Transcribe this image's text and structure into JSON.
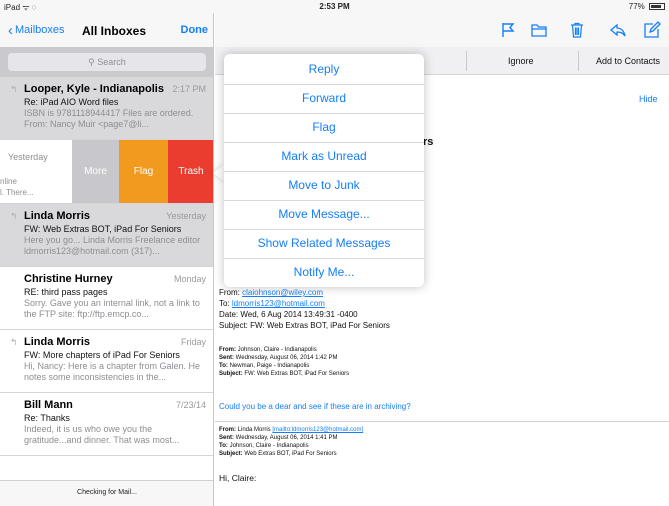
{
  "status_bar": {
    "left": "iPad ᯤ ◌",
    "time": "2:53 PM",
    "battery": "77%"
  },
  "mailbox": {
    "back_label": "Mailboxes",
    "title": "All Inboxes",
    "done_label": "Done",
    "search_placeholder": "Search",
    "messages": [
      {
        "sender": "Looper, Kyle - Indianapolis",
        "date": "2:17 PM",
        "subject": "Re: iPad AIO Word files",
        "preview": "ISBN is 9781118944417 Files are ordered. From: Nancy Muir <page7@li..."
      },
      {
        "sender": "Linda Morris",
        "date": "Yesterday",
        "subject": "FW: Web Extras BOT, iPad For Seniors",
        "preview": "Here you go... Linda Morris Freelance editor ldmorris123@hotmail.com (317)..."
      },
      {
        "sender": "Christine Hurney",
        "date": "Monday",
        "subject": "RE: third pass pages",
        "preview": "Sorry. Gave you an internal link, not a link to the FTP site: ftp://ftp.emcp.co..."
      },
      {
        "sender": "Linda Morris",
        "date": "Friday",
        "subject": "FW: More chapters of iPad For Seniors",
        "preview": "Hi, Nancy: Here is a chapter from Galen. He notes some inconsistencies in the..."
      },
      {
        "sender": "Bill Mann",
        "date": "7/23/14",
        "subject": "Re: Thanks",
        "preview": "Indeed, it is us who owe you the gratitude...and dinner. That was most..."
      }
    ],
    "swiped_row": {
      "date": "Yesterday",
      "line1": "nline",
      "line2": "l. There...",
      "more_label": "More",
      "flag_label": "Flag",
      "trash_label": "Trash"
    },
    "footer_status": "Checking for Mail..."
  },
  "toolbar": {
    "icons": [
      "flag-icon",
      "folder-icon",
      "trash-icon",
      "reply-icon",
      "compose-icon"
    ]
  },
  "contact_bar": {
    "ignore_label": "Ignore",
    "add_label": "Add to Contacts"
  },
  "message": {
    "hide_label": "Hide",
    "subject_fragment": "rs",
    "from_label": "From:",
    "from_value": "claiohnson@wiley.com",
    "to_label": "To:",
    "to_value": "ldmorris123@hotmail.com",
    "date_line": "Date: Wed, 6 Aug 2014 13:49:31 -0400",
    "subject_line": "Subject: FW: Web Extras BOT, iPad For Seniors",
    "block1": {
      "from_label": "From:",
      "from_value": "Johnson, Claire - Indianapolis",
      "sent_label": "Sent:",
      "sent_value": "Wednesday, August 06, 2014 1:42 PM",
      "to_label": "To:",
      "to_value": "Newman, Paige - Indianapolis",
      "subject_label": "Subject:",
      "subject_value": "FW: Web Extras BOT, iPad For Seniors"
    },
    "question": "Could you be a dear and see if these are in archiving?",
    "block2": {
      "from_label": "From:",
      "from_value": "Linda Morris",
      "from_link": "[mailto:ldmorris123@hotmail.com]",
      "sent_label": "Sent:",
      "sent_value": "Wednesday, August 06, 2014 1:41 PM",
      "to_label": "To:",
      "to_value": "Johnson, Claire - Indianapolis",
      "subject_label": "Subject:",
      "subject_value": "Web Extras BOT, iPad For Seniors"
    },
    "greeting": "Hi, Claire:"
  },
  "popover": {
    "items": [
      "Reply",
      "Forward",
      "Flag",
      "Mark as Unread",
      "Move to Junk",
      "Move Message...",
      "Show Related Messages",
      "Notify Me..."
    ]
  },
  "colors": {
    "accent": "#147efb",
    "flag": "#f29a1e",
    "trash": "#ea3c2f",
    "more": "#c7c7cc"
  }
}
